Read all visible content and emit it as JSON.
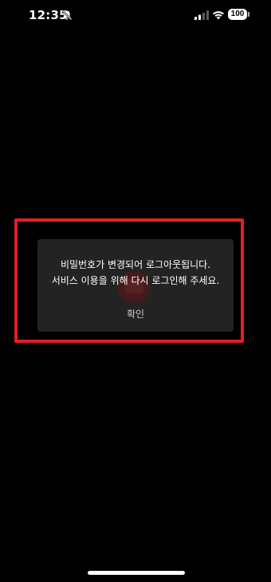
{
  "status_bar": {
    "time": "12:35",
    "battery": "100",
    "icons": [
      "bell-off-icon",
      "signal-icon",
      "wifi-icon",
      "battery-icon"
    ]
  },
  "dialog": {
    "message_line1": "비밀번호가 변경되어 로그아웃됩니다.",
    "message_line2": "서비스 이용을 위해 다시 로그인해 주세요.",
    "confirm_label": "확인"
  },
  "colors": {
    "background": "#000000",
    "dialog_background": "#232323",
    "highlight": "#e41e26"
  }
}
